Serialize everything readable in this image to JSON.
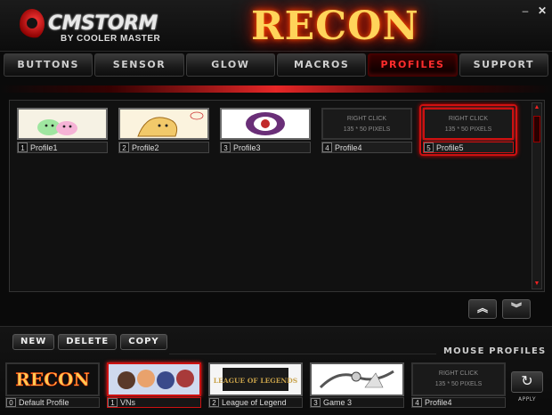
{
  "header": {
    "brand_name": "CMSTORM",
    "brand_sub": "BY COOLER MASTER",
    "title": "RECON",
    "minimize_label": "–",
    "close_label": "✕"
  },
  "tabs": [
    {
      "label": "BUTTONS"
    },
    {
      "label": "SENSOR"
    },
    {
      "label": "GLOW"
    },
    {
      "label": "MACROS"
    },
    {
      "label": "PROFILES"
    },
    {
      "label": "SUPPORT"
    }
  ],
  "profiles": {
    "placeholder_line1": "RIGHT CLICK",
    "placeholder_line2": "135 * 50 PIXELS",
    "items": [
      {
        "num": "1",
        "name": "Profile1"
      },
      {
        "num": "2",
        "name": "Profile2"
      },
      {
        "num": "3",
        "name": "Profile3"
      },
      {
        "num": "4",
        "name": "Profile4"
      },
      {
        "num": "5",
        "name": "Profile5"
      }
    ],
    "scroll_up_label": "︽",
    "scroll_down_label": "︾"
  },
  "actions": {
    "new_label": "NEW",
    "delete_label": "DELETE",
    "copy_label": "COPY"
  },
  "mouse_profiles": {
    "title": "MOUSE PROFILES",
    "items": [
      {
        "num": "0",
        "name": "Default Profile",
        "art": "RECON"
      },
      {
        "num": "1",
        "name": "VNs"
      },
      {
        "num": "2",
        "name": "League of Legend",
        "art": "LEAGUE OF LEGENDS"
      },
      {
        "num": "3",
        "name": "Game 3"
      },
      {
        "num": "4",
        "name": "Profile4"
      }
    ],
    "placeholder_line1": "RIGHT CLICK",
    "placeholder_line2": "135 * 50 PIXELS",
    "apply_label": "APPLY",
    "apply_icon": "↻"
  },
  "colors": {
    "accent": "#ff2a2a",
    "title_glow": "#ff5000"
  }
}
